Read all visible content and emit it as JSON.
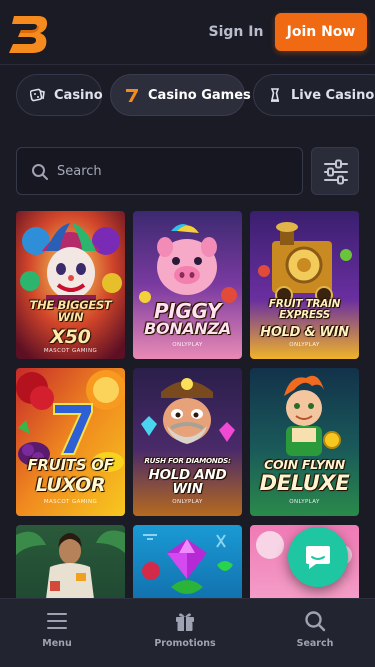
{
  "header": {
    "logo": "b-logo",
    "sign_in": "Sign In",
    "join_now": "Join Now"
  },
  "tabs": [
    {
      "label": "Casino",
      "icon": "dice-icon",
      "active": false
    },
    {
      "label": "Casino Games",
      "icon": "seven-icon",
      "active": true
    },
    {
      "label": "Live Casino",
      "icon": "chess-piece-icon",
      "active": false
    }
  ],
  "search": {
    "placeholder": "Search",
    "value": ""
  },
  "games": [
    {
      "line1": "THE BIGGEST WIN",
      "line2": "X50",
      "provider": "MASCOT GAMING"
    },
    {
      "line1": "PIGGY",
      "line2": "BONANZA",
      "provider": "ONLYPLAY"
    },
    {
      "line1": "FRUIT TRAIN EXPRESS",
      "line2": "HOLD & WIN",
      "provider": "ONLYPLAY"
    },
    {
      "line1": "FRUITS OF",
      "line2": "LUXOR",
      "provider": "MASCOT GAMING"
    },
    {
      "line1": "RUSH FOR DIAMONDS:",
      "line2": "HOLD AND WIN",
      "provider": "ONLYPLAY"
    },
    {
      "line1": "COIN FLYNN",
      "line2": "DELUXE",
      "provider": "ONLYPLAY"
    },
    {
      "line1": "",
      "line2": "",
      "provider": ""
    },
    {
      "line1": "",
      "line2": "",
      "provider": ""
    },
    {
      "line1": "",
      "line2": "",
      "provider": ""
    }
  ],
  "bottom_nav": [
    {
      "label": "Menu",
      "icon": "hamburger-icon"
    },
    {
      "label": "Promotions",
      "icon": "gift-icon"
    },
    {
      "label": "Search",
      "icon": "search-icon"
    }
  ],
  "colors": {
    "background": "#1a1b25",
    "accent": "#f06a13",
    "chat": "#1ec7a2"
  }
}
